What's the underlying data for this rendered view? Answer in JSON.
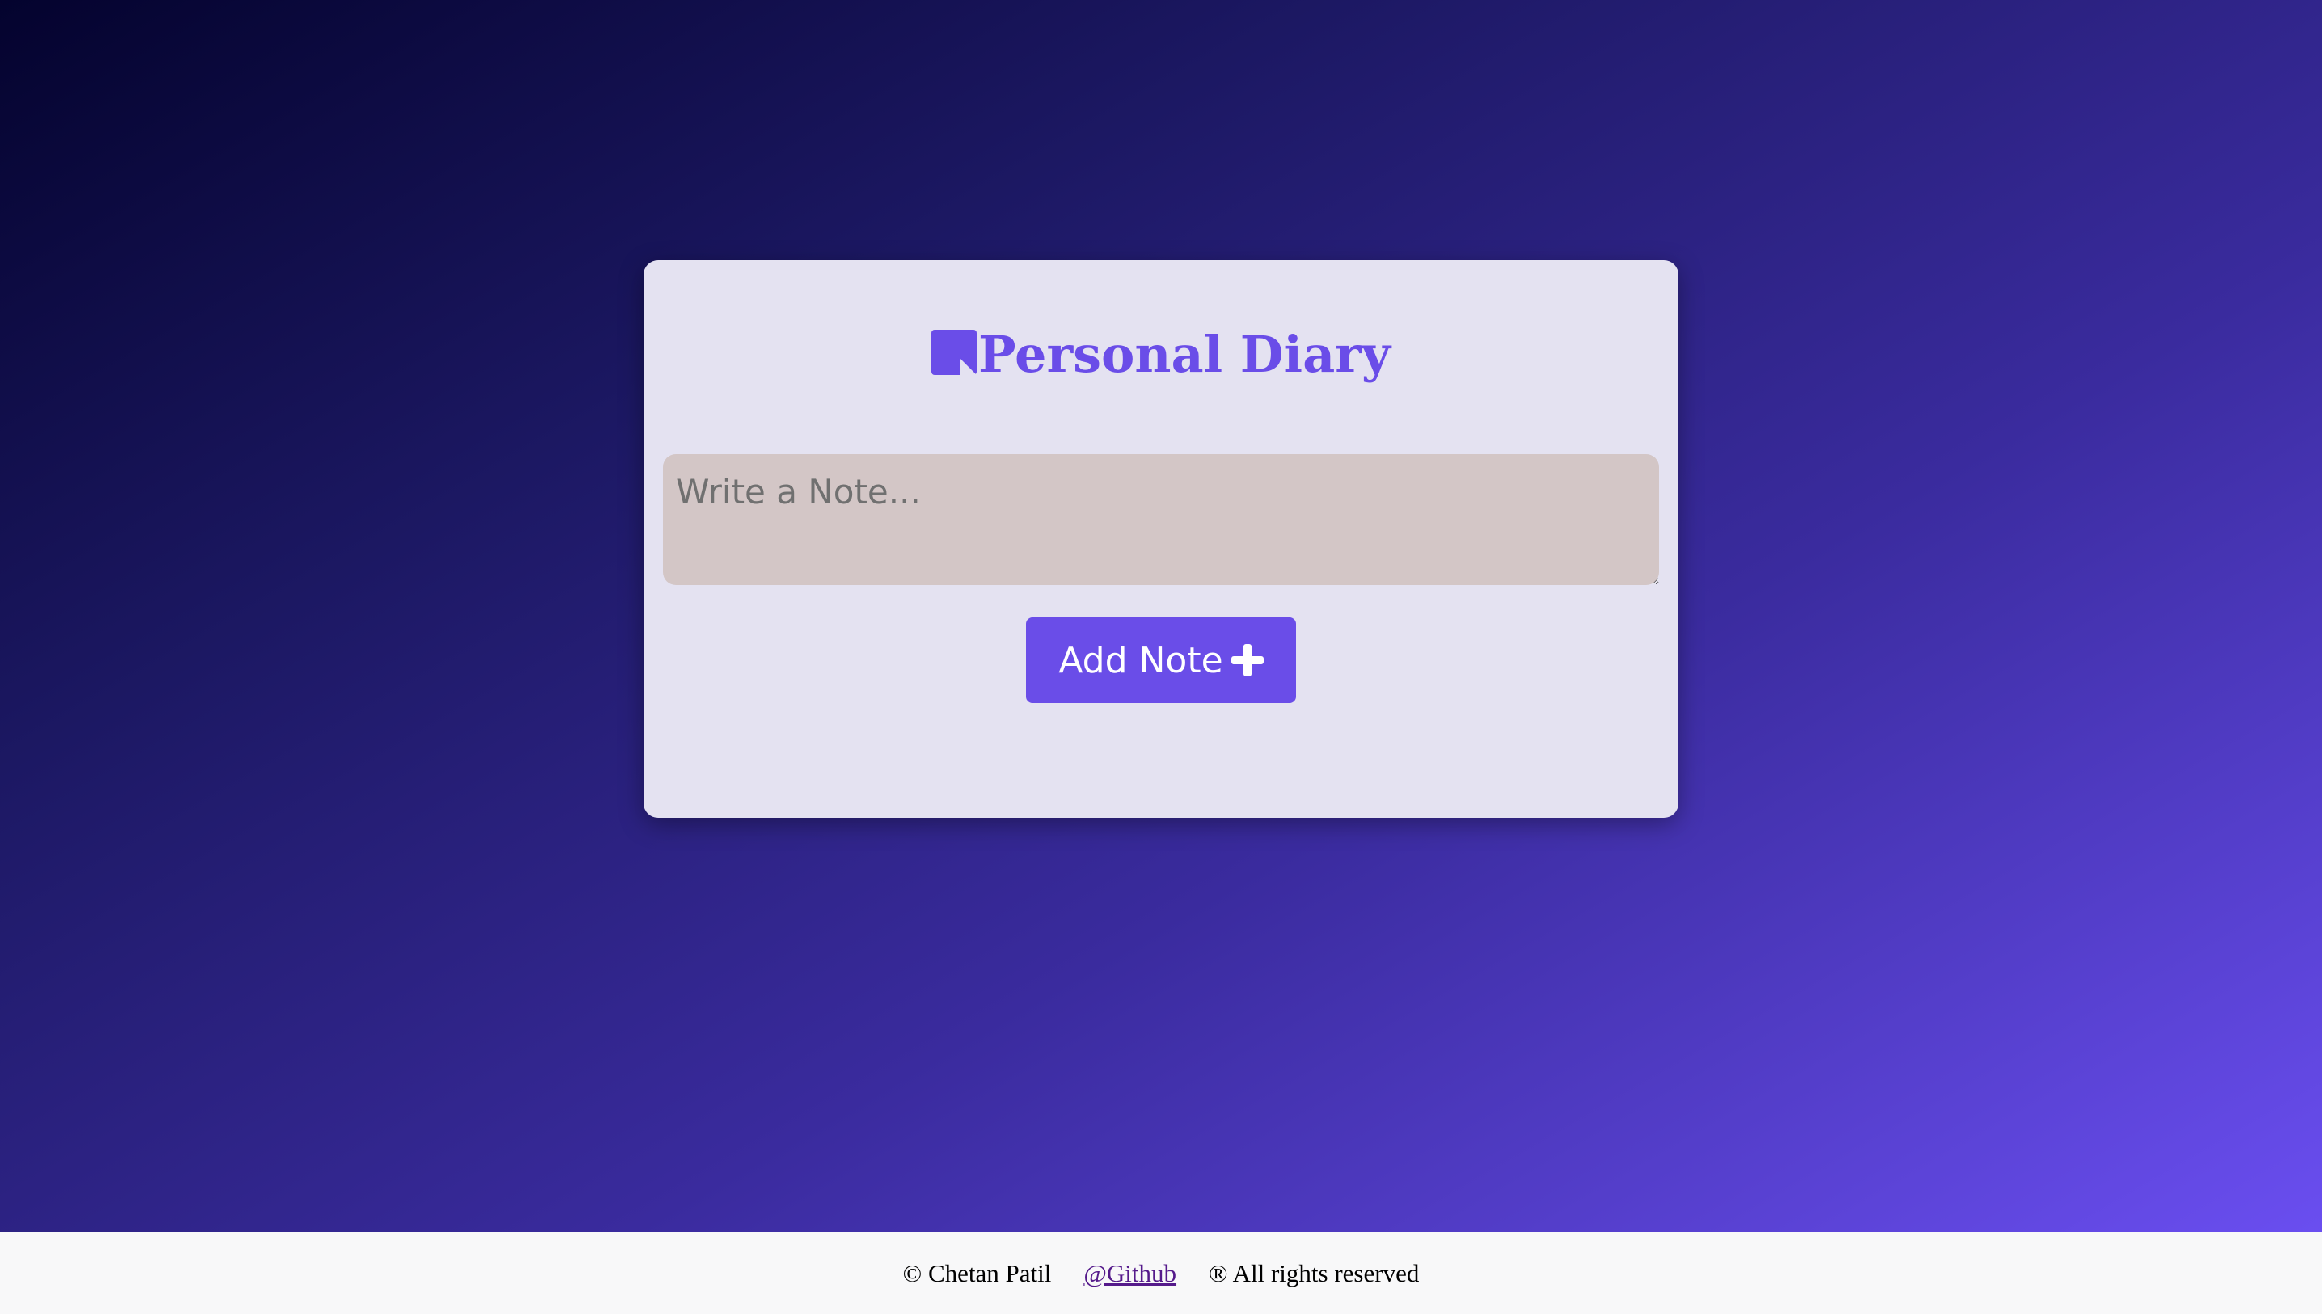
{
  "app": {
    "title": "Personal Diary",
    "title_icon": "sticky-note-icon",
    "accent_color": "#6a4de8"
  },
  "note_input": {
    "placeholder": "Write a Note...",
    "value": ""
  },
  "add_button": {
    "label": "Add Note",
    "icon": "plus-icon"
  },
  "footer": {
    "copyright": "© Chetan Patil",
    "github_link": "@Github",
    "rights": "® All rights reserved"
  }
}
